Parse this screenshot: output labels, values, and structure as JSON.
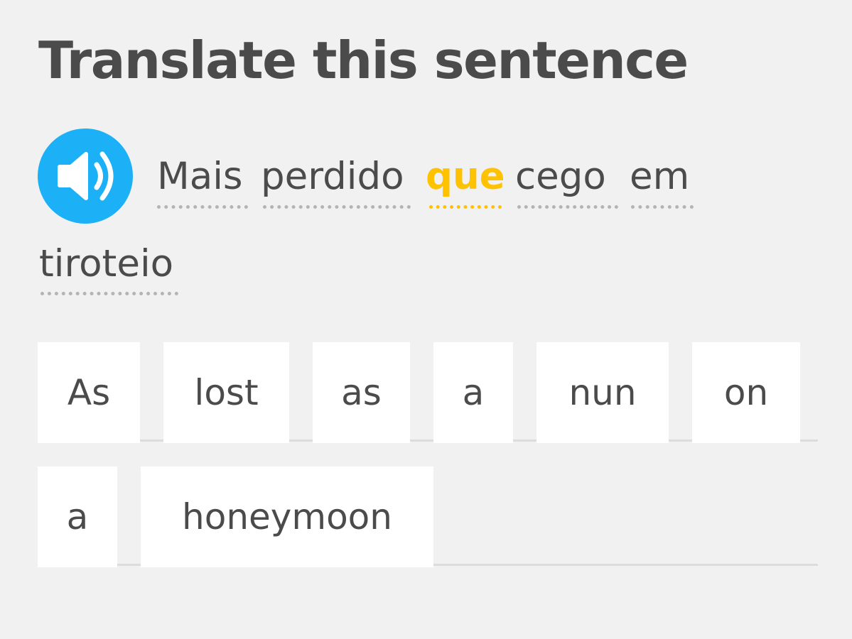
{
  "header": {
    "title": "Translate this sentence"
  },
  "prompt": {
    "audio_icon": "speaker-icon",
    "words": [
      "Mais",
      "perdido",
      "que",
      "cego",
      "em",
      "tiroteio"
    ],
    "highlighted_word": "que"
  },
  "answer": {
    "tiles": [
      "As",
      "lost",
      "as",
      "a",
      "nun",
      "on",
      "a",
      "honeymoon"
    ]
  },
  "colors": {
    "background": "#f1f1f1",
    "text": "#4b4b4b",
    "accent_blue": "#1cb0f6",
    "highlight_yellow": "#ffc200",
    "tile": "#ffffff"
  }
}
